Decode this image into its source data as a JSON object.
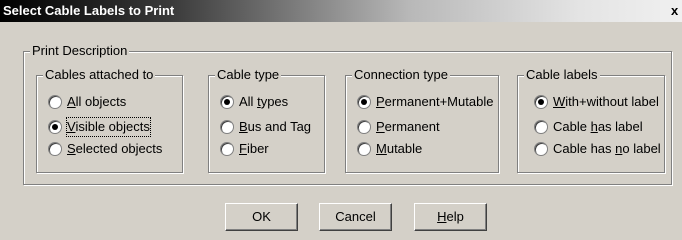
{
  "window": {
    "title": "Select Cable Labels to Print",
    "close_glyph": "x"
  },
  "print_description": {
    "label": "Print Description",
    "cables_attached_to": {
      "label": "Cables attached to",
      "options": [
        {
          "pre": "",
          "mn": "A",
          "post": "ll objects",
          "selected": false
        },
        {
          "pre": "",
          "mn": "V",
          "post": "isible objects",
          "selected": true
        },
        {
          "pre": "",
          "mn": "S",
          "post": "elected objects",
          "selected": false
        }
      ]
    },
    "cable_type": {
      "label": "Cable type",
      "options": [
        {
          "pre": "All ",
          "mn": "t",
          "post": "ypes",
          "selected": true
        },
        {
          "pre": "",
          "mn": "B",
          "post": "us and Tag",
          "selected": false
        },
        {
          "pre": "",
          "mn": "F",
          "post": "iber",
          "selected": false
        }
      ]
    },
    "connection_type": {
      "label": "Connection type",
      "options": [
        {
          "pre": "",
          "mn": "P",
          "post": "ermanent+Mutable",
          "selected": true
        },
        {
          "pre": "",
          "mn": "P",
          "post": "ermanent",
          "selected": false
        },
        {
          "pre": "",
          "mn": "M",
          "post": "utable",
          "selected": false
        }
      ]
    },
    "cable_labels": {
      "label": "Cable labels",
      "options": [
        {
          "pre": "",
          "mn": "W",
          "post": "ith+without label",
          "selected": true
        },
        {
          "pre": "Cable ",
          "mn": "h",
          "post": "as label",
          "selected": false
        },
        {
          "pre": "Cable has ",
          "mn": "n",
          "post": "o label",
          "selected": false
        }
      ]
    }
  },
  "buttons": {
    "ok": "OK",
    "cancel": "Cancel",
    "help": {
      "pre": "",
      "mn": "H",
      "post": "elp"
    }
  }
}
